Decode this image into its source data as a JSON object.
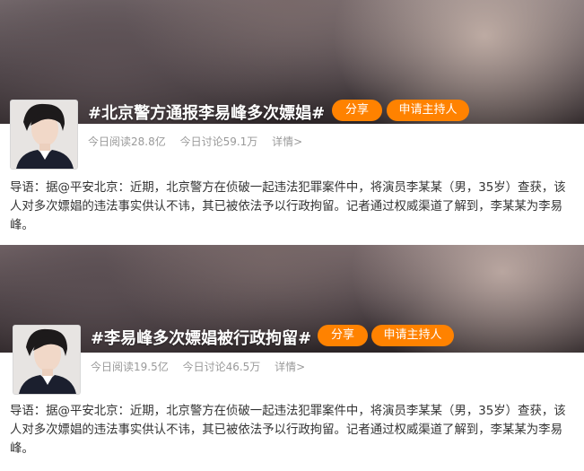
{
  "cards": [
    {
      "title": "#北京警方通报李易峰多次嫖娼#",
      "share_label": "分享",
      "host_label": "申请主持人",
      "reads": "今日阅读28.8亿",
      "discussions": "今日讨论59.1万",
      "detail_label": "详情>",
      "intro": "导语：据@平安北京：近期，北京警方在侦破一起违法犯罪案件中，将演员李某某（男，35岁）查获，该人对多次嫖娼的违法事实供认不讳，其已被依法予以行政拘留。记者通过权威渠道了解到，李某某为李易峰。"
    },
    {
      "title": "#李易峰多次嫖娼被行政拘留#",
      "share_label": "分享",
      "host_label": "申请主持人",
      "reads": "今日阅读19.5亿",
      "discussions": "今日讨论46.5万",
      "detail_label": "详情>",
      "intro": "导语：据@平安北京：近期，北京警方在侦破一起违法犯罪案件中，将演员李某某（男，35岁）查获，该人对多次嫖娼的违法事实供认不讳，其已被依法予以行政拘留。记者通过权威渠道了解到，李某某为李易峰。"
    }
  ],
  "colors": {
    "accent": "#ff8200",
    "muted": "#9a9a9a",
    "text": "#333333"
  }
}
